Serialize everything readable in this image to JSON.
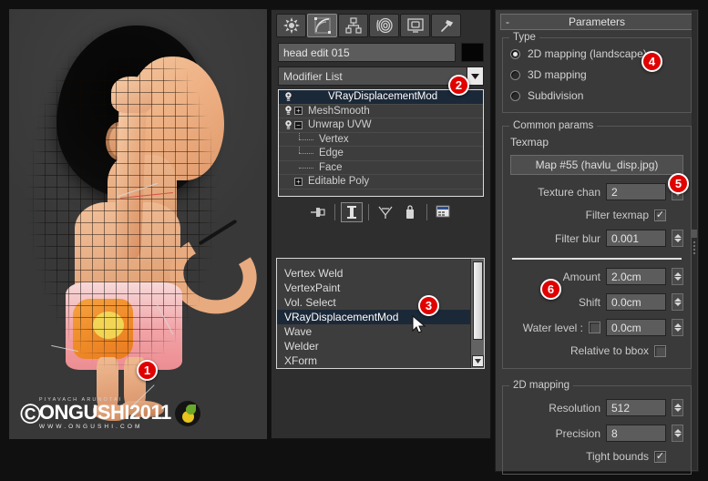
{
  "viewport": {
    "name": "perspective-viewport",
    "subject": "3d-character-head-wireframe",
    "watermark": {
      "copyright": "©",
      "author": "PIYAVACH ARUNOTAI",
      "brand": "ONGUSHI2011",
      "site": "WWW.ONGUSHI.COM"
    }
  },
  "command_panel": {
    "tabs": [
      {
        "icon": "create-icon",
        "label": "Create",
        "active": false
      },
      {
        "icon": "modify-icon",
        "label": "Modify",
        "active": true
      },
      {
        "icon": "hierarchy-icon",
        "label": "Hierarchy",
        "active": false
      },
      {
        "icon": "motion-icon",
        "label": "Motion",
        "active": false
      },
      {
        "icon": "display-icon",
        "label": "Display",
        "active": false
      },
      {
        "icon": "utilities-icon",
        "label": "Utilities",
        "active": false
      }
    ],
    "object_name": "head edit 015",
    "object_color": "#050505",
    "modifier_list_label": "Modifier List",
    "stack": [
      {
        "label": "VRayDisplacementMod",
        "expand": "none",
        "selected": true,
        "indent": 0
      },
      {
        "label": "MeshSmooth",
        "expand": "plus",
        "selected": false,
        "indent": 0
      },
      {
        "label": "Unwrap UVW",
        "expand": "minus",
        "selected": false,
        "indent": 0
      },
      {
        "label": "Vertex",
        "expand": "none",
        "selected": false,
        "indent": 1
      },
      {
        "label": "Edge",
        "expand": "none",
        "selected": false,
        "indent": 1
      },
      {
        "label": "Face",
        "expand": "none",
        "selected": false,
        "indent": 1
      },
      {
        "label": "Editable Poly",
        "expand": "plus",
        "selected": false,
        "indent": 0
      }
    ],
    "stack_tools": [
      {
        "icon": "pin-stack-icon",
        "label": "Pin Stack"
      },
      {
        "icon": "show-end-result-icon",
        "label": "Show End Result",
        "framed": true
      },
      {
        "icon": "make-unique-icon",
        "label": "Make Unique"
      },
      {
        "icon": "remove-modifier-icon",
        "label": "Remove Modifier"
      },
      {
        "icon": "configure-sets-icon",
        "label": "Configure Modifier Sets"
      }
    ],
    "dropdown_items": [
      {
        "label": "Vertex Weld",
        "selected": false
      },
      {
        "label": "VertexPaint",
        "selected": false
      },
      {
        "label": "Vol. Select",
        "selected": false
      },
      {
        "label": "VRayDisplacementMod",
        "selected": true
      },
      {
        "label": "Wave",
        "selected": false
      },
      {
        "label": "Welder",
        "selected": false
      },
      {
        "label": "XForm",
        "selected": false
      }
    ]
  },
  "parameters": {
    "rollout_title": "Parameters",
    "rollout_toggle": "-",
    "type_group": {
      "title": "Type",
      "options": [
        {
          "label": "2D mapping (landscape)",
          "selected": true
        },
        {
          "label": "3D mapping",
          "selected": false
        },
        {
          "label": "Subdivision",
          "selected": false
        }
      ]
    },
    "common_group": {
      "title": "Common params",
      "texmap_label": "Texmap",
      "map_button": "Map #55 (havlu_disp.jpg)",
      "texture_chan_label": "Texture chan",
      "texture_chan_value": "2",
      "filter_texmap_label": "Filter texmap",
      "filter_texmap_checked": true,
      "filter_blur_label": "Filter blur",
      "filter_blur_value": "0.001",
      "amount_label": "Amount",
      "amount_value": "2.0cm",
      "shift_label": "Shift",
      "shift_value": "0.0cm",
      "water_level_label": "Water level :",
      "water_level_checked": false,
      "water_level_value": "0.0cm",
      "relative_bbox_label": "Relative to bbox",
      "relative_bbox_checked": false
    },
    "mapping_group": {
      "title": "2D mapping",
      "resolution_label": "Resolution",
      "resolution_value": "512",
      "precision_label": "Precision",
      "precision_value": "8",
      "tight_bounds_label": "Tight bounds",
      "tight_bounds_checked": true
    }
  },
  "annotations": [
    {
      "number": "1",
      "target": "viewport-model"
    },
    {
      "number": "2",
      "target": "modifier-list-dropdown"
    },
    {
      "number": "3",
      "target": "vraydisplacementmod-option"
    },
    {
      "number": "4",
      "target": "2d-mapping-radio"
    },
    {
      "number": "5",
      "target": "texmap-map-button"
    },
    {
      "number": "6",
      "target": "amount-field"
    }
  ],
  "colors": {
    "badge": "#e00000",
    "selection": "#1b2838",
    "panel_bg": "#3a3a3a",
    "field_bg": "#5c5c5c"
  }
}
